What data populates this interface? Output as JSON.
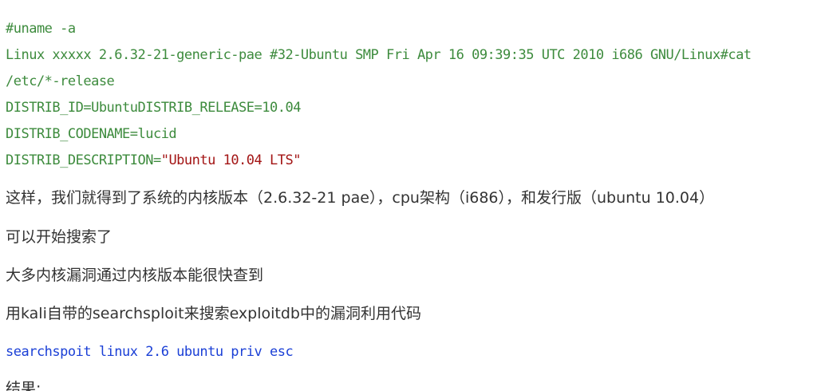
{
  "code_block_1": {
    "lines": [
      "#uname -a",
      "Linux xxxxx 2.6.32-21-generic-pae #32-Ubuntu SMP Fri Apr 16 09:39:35 UTC 2010 i686 GNU/Linux#cat",
      "/etc/*-release",
      "DISTRIB_ID=UbuntuDISTRIB_RELEASE=10.04",
      "DISTRIB_CODENAME=lucid"
    ],
    "last_line_key": "DISTRIB_DESCRIPTION=",
    "last_line_value": "\"Ubuntu 10.04 LTS\""
  },
  "paragraphs": [
    "这样，我们就得到了系统的内核版本（2.6.32-21 pae），cpu架构（i686），和发行版（ubuntu 10.04）",
    "可以开始搜索了",
    "大多内核漏洞通过内核版本能很快查到",
    "用kali自带的searchsploit来搜索exploitdb中的漏洞利用代码"
  ],
  "code_block_2": {
    "command": "searchspoit linux 2.6 ubuntu priv esc"
  },
  "trailing_text": "结果:",
  "colors": {
    "code_green": "#3d8b3d",
    "code_string_red": "#a31515",
    "code_blue": "#1a3fd6",
    "body_text": "#333333"
  }
}
